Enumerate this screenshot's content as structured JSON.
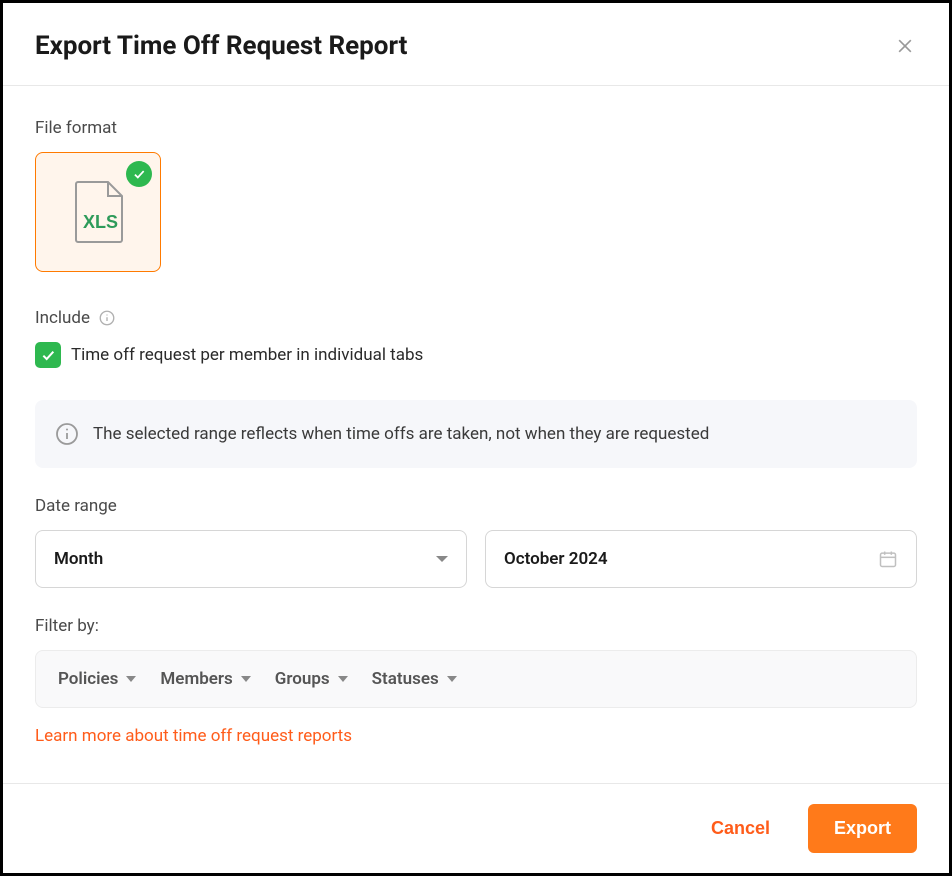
{
  "header": {
    "title": "Export Time Off Request Report"
  },
  "fileFormat": {
    "label": "File format",
    "selected": "XLS"
  },
  "include": {
    "label": "Include",
    "option": "Time off request per member in individual tabs"
  },
  "infoBanner": "The selected range reflects when time offs are taken, not when they are requested",
  "dateRange": {
    "label": "Date range",
    "granularity": "Month",
    "value": "October 2024"
  },
  "filterBy": {
    "label": "Filter by:",
    "items": [
      "Policies",
      "Members",
      "Groups",
      "Statuses"
    ]
  },
  "learnMore": "Learn more about time off request reports",
  "footer": {
    "cancel": "Cancel",
    "export": "Export"
  }
}
